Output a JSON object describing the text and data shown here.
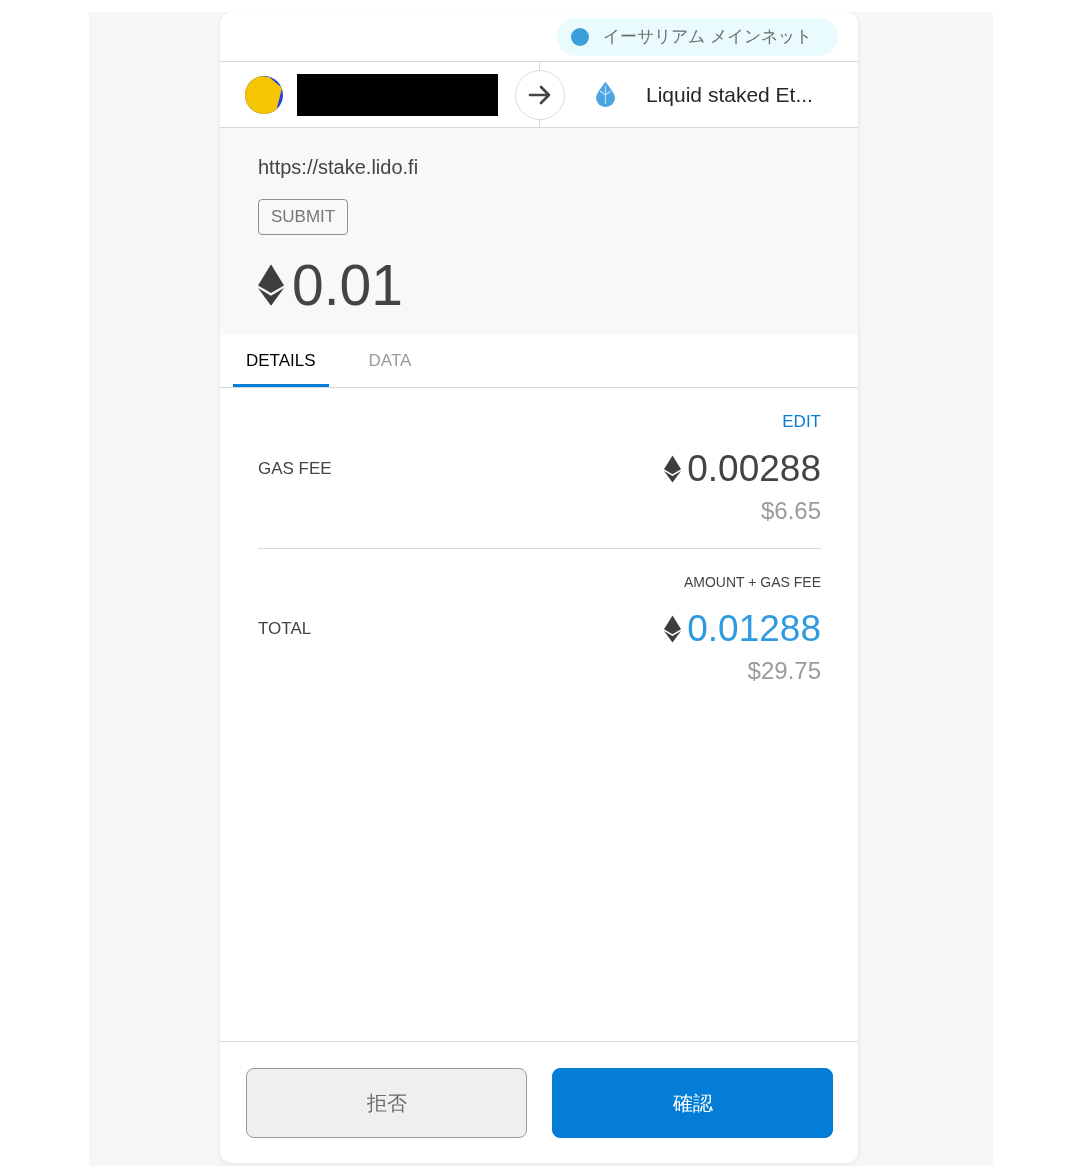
{
  "network": {
    "name": "イーサリアム メインネット"
  },
  "recipient": {
    "name": "Liquid staked Et..."
  },
  "origin": "https://stake.lido.fi",
  "method": "SUBMIT",
  "amount": "0.01",
  "tabs": [
    {
      "label": "DETAILS",
      "selected": true
    },
    {
      "label": "DATA",
      "selected": false
    }
  ],
  "fees": [
    {
      "kind": "gas",
      "action": "EDIT",
      "label": "GAS FEE",
      "value": "0.00288",
      "fiat": "$6.65"
    },
    {
      "kind": "total",
      "caption": "AMOUNT + GAS FEE",
      "label": "TOTAL",
      "value": "0.01288",
      "fiat": "$29.75"
    }
  ],
  "buttons": [
    {
      "kind": "secondary",
      "label": "拒否"
    },
    {
      "kind": "primary",
      "label": "確認"
    }
  ]
}
